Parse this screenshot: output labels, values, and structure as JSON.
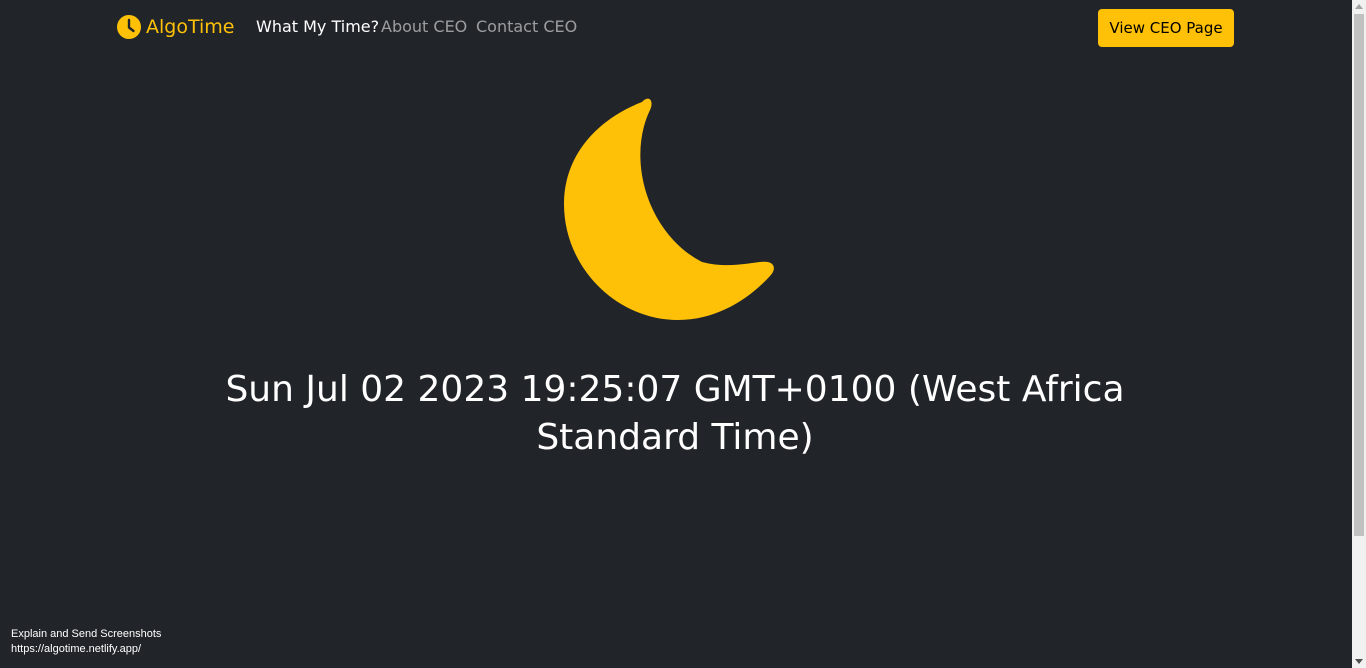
{
  "navbar": {
    "brand": "AlgoTime",
    "brand_icon": "clock-icon",
    "links": [
      {
        "label": "What My Time?",
        "active": true
      },
      {
        "label": "About CEO",
        "active": false
      },
      {
        "label": "Contact CEO",
        "active": false
      }
    ],
    "cta_label": "View CEO Page"
  },
  "hero": {
    "icon": "moon-icon",
    "datetime": "Sun Jul 02 2023 19:25:07 GMT+0100 (West Africa Standard Time)"
  },
  "overlay": {
    "line1": "Explain and Send Screenshots",
    "line2": "https://algotime.netlify.app/"
  },
  "colors": {
    "background": "#212529",
    "accent": "#ffc107",
    "nav_muted": "rgba(255,255,255,0.55)",
    "text": "#ffffff"
  }
}
